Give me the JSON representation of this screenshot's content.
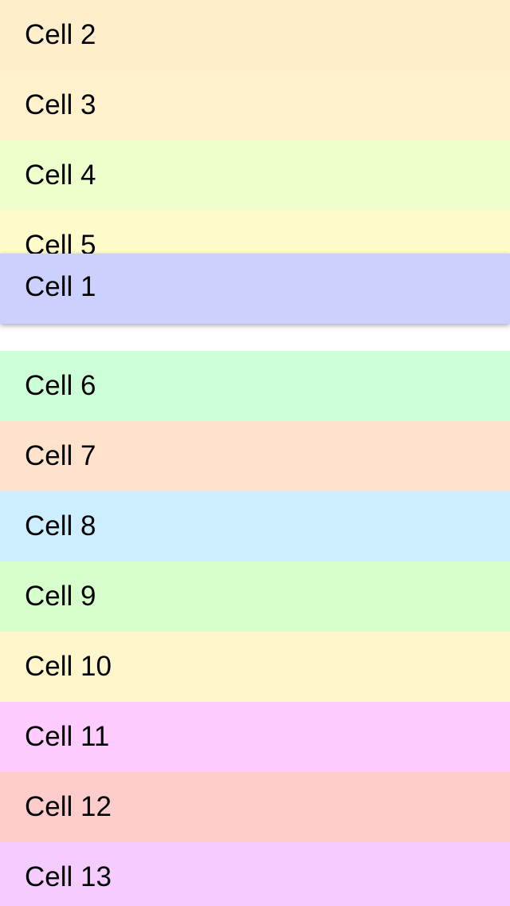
{
  "list": {
    "cells": [
      {
        "label": "Cell 2",
        "color": "#FFEECC"
      },
      {
        "label": "Cell 3",
        "color": "#FFF2CC"
      },
      {
        "label": "Cell 4",
        "color": "#EEFFCC"
      },
      {
        "label": "Cell 5",
        "color": "#FFFCCC"
      },
      {
        "label": "Cell 6",
        "color": "#CCFFD8"
      },
      {
        "label": "Cell 7",
        "color": "#FFE2CC"
      },
      {
        "label": "Cell 8",
        "color": "#CCEEFF"
      },
      {
        "label": "Cell 9",
        "color": "#D6FFCC"
      },
      {
        "label": "Cell 10",
        "color": "#FFF6CC"
      },
      {
        "label": "Cell 11",
        "color": "#FFCCFF"
      },
      {
        "label": "Cell 12",
        "color": "#FFCCCC"
      },
      {
        "label": "Cell 13",
        "color": "#F5CCFF"
      }
    ],
    "dragged_cell": {
      "label": "Cell 1",
      "color": "#CCD0FF"
    }
  }
}
